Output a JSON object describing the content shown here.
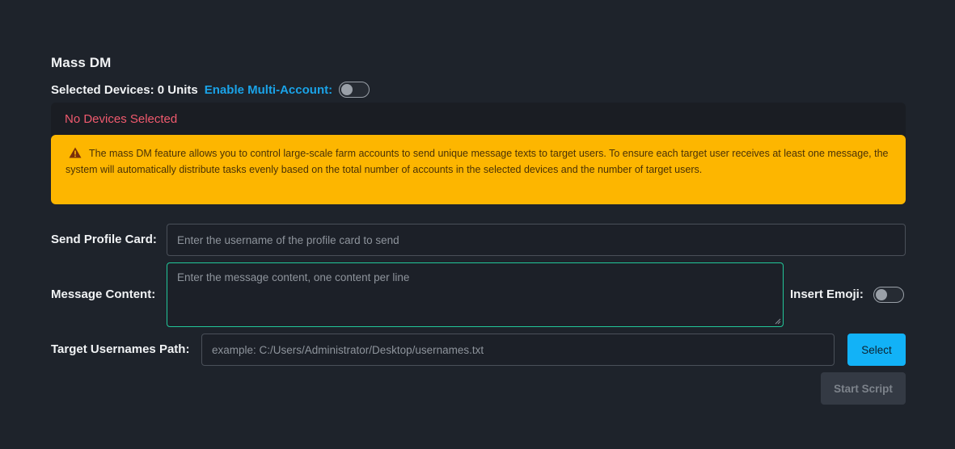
{
  "page": {
    "title": "Mass DM"
  },
  "devices": {
    "selected_label": "Selected Devices: 0 Units",
    "multi_account_label": "Enable Multi-Account:",
    "multi_account_enabled": false,
    "empty_message": "No Devices Selected"
  },
  "warning": {
    "icon": "warning-triangle-icon",
    "text": "The mass DM feature allows you to control large-scale farm accounts to send unique message texts to target users. To ensure each target user receives at least one message, the system will automatically distribute tasks evenly based on the total number of accounts in the selected devices and the number of target users."
  },
  "form": {
    "profile_card": {
      "label": "Send Profile Card:",
      "placeholder": "Enter the username of the profile card to send",
      "value": ""
    },
    "message_content": {
      "label": "Message Content:",
      "placeholder": "Enter the message content, one content per line",
      "value": ""
    },
    "insert_emoji": {
      "label": "Insert Emoji:",
      "enabled": false
    },
    "target_path": {
      "label": "Target Usernames Path:",
      "placeholder": "example: C:/Users/Administrator/Desktop/usernames.txt",
      "value": "",
      "select_label": "Select"
    },
    "start_label": "Start Script"
  },
  "colors": {
    "background": "#1e232b",
    "accent_blue": "#12b2f7",
    "link_blue": "#1aa3e8",
    "warning_bg": "#fdb600",
    "error_text": "#f05a6e",
    "focus_green": "#22c79a"
  }
}
